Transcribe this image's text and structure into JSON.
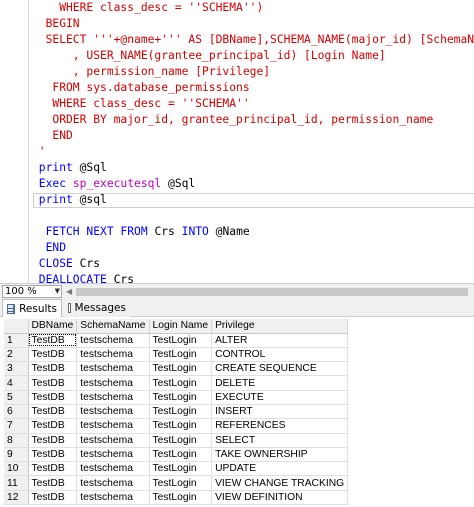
{
  "editor": {
    "lines": [
      [
        {
          "t": "    WHERE class_desc = ''SCHEMA'')",
          "c": "red"
        }
      ],
      [
        {
          "t": "  BEGIN",
          "c": "red"
        }
      ],
      [
        {
          "t": "  SELECT '''+@name+''' AS [DBName],SCHEMA_NAME(major_id) [SchemaName]",
          "c": "red"
        }
      ],
      [
        {
          "t": "      , USER_NAME(grantee_principal_id) [Login Name]",
          "c": "red"
        }
      ],
      [
        {
          "t": "      , permission_name [Privilege]",
          "c": "red"
        }
      ],
      [
        {
          "t": "   FROM sys.database_permissions",
          "c": "red"
        }
      ],
      [
        {
          "t": "   WHERE class_desc = ''SCHEMA''",
          "c": "red"
        }
      ],
      [
        {
          "t": "   ORDER BY major_id, grantee_principal_id, permission_name",
          "c": "red"
        }
      ],
      [
        {
          "t": "   END",
          "c": "red"
        }
      ],
      [
        {
          "t": " '",
          "c": "red"
        }
      ],
      [
        {
          "t": " print ",
          "c": "blue"
        },
        {
          "t": "@Sql",
          "c": "plain"
        }
      ],
      [
        {
          "t": " Exec ",
          "c": "blue"
        },
        {
          "t": "sp_executesql",
          "c": "magenta"
        },
        {
          "t": " @Sql",
          "c": "plain"
        }
      ],
      [
        {
          "t": " print ",
          "c": "blue"
        },
        {
          "t": "@sql",
          "c": "plain"
        }
      ],
      [
        {
          "t": "",
          "c": "plain"
        }
      ],
      [
        {
          "t": "  FETCH NEXT FROM ",
          "c": "blue"
        },
        {
          "t": "Crs ",
          "c": "plain"
        },
        {
          "t": "INTO ",
          "c": "blue"
        },
        {
          "t": "@Name",
          "c": "plain"
        }
      ],
      [
        {
          "t": "  END",
          "c": "blue"
        }
      ],
      [
        {
          "t": " CLOSE ",
          "c": "blue"
        },
        {
          "t": "Crs",
          "c": "plain"
        }
      ],
      [
        {
          "t": " DEALLOCATE ",
          "c": "blue"
        },
        {
          "t": "Crs",
          "c": "plain"
        }
      ]
    ]
  },
  "statusbar": {
    "zoom": "100 %",
    "zoom_arrow": "▼",
    "scroll_left": "◀"
  },
  "tabs": {
    "results": "Results",
    "messages": "Messages"
  },
  "grid": {
    "headers": [
      "DBName",
      "SchemaName",
      "Login Name",
      "Privilege"
    ],
    "rows": [
      [
        "1",
        "TestDB",
        "testschema",
        "TestLogin",
        "ALTER"
      ],
      [
        "2",
        "TestDB",
        "testschema",
        "TestLogin",
        "CONTROL"
      ],
      [
        "3",
        "TestDB",
        "testschema",
        "TestLogin",
        "CREATE SEQUENCE"
      ],
      [
        "4",
        "TestDB",
        "testschema",
        "TestLogin",
        "DELETE"
      ],
      [
        "5",
        "TestDB",
        "testschema",
        "TestLogin",
        "EXECUTE"
      ],
      [
        "6",
        "TestDB",
        "testschema",
        "TestLogin",
        "INSERT"
      ],
      [
        "7",
        "TestDB",
        "testschema",
        "TestLogin",
        "REFERENCES"
      ],
      [
        "8",
        "TestDB",
        "testschema",
        "TestLogin",
        "SELECT"
      ],
      [
        "9",
        "TestDB",
        "testschema",
        "TestLogin",
        "TAKE OWNERSHIP"
      ],
      [
        "10",
        "TestDB",
        "testschema",
        "TestLogin",
        "UPDATE"
      ],
      [
        "11",
        "TestDB",
        "testschema",
        "TestLogin",
        "VIEW CHANGE TRACKING"
      ],
      [
        "12",
        "TestDB",
        "testschema",
        "TestLogin",
        "VIEW DEFINITION"
      ]
    ]
  }
}
